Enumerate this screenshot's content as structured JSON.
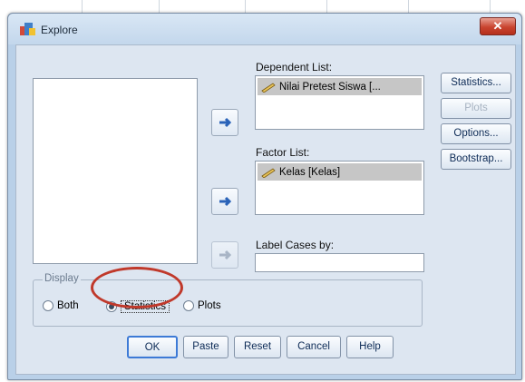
{
  "window": {
    "title": "Explore",
    "close_glyph": "✕"
  },
  "buttons_side": {
    "statistics": "Statistics...",
    "plots": "Plots",
    "options": "Options...",
    "bootstrap": "Bootstrap..."
  },
  "lists": {
    "dependent_label": "Dependent List:",
    "dependent_items": [
      "Nilai Pretest Siswa [..."
    ],
    "factor_label": "Factor List:",
    "factor_items": [
      "Kelas [Kelas]"
    ],
    "label_cases_label": "Label Cases by:",
    "label_cases_value": ""
  },
  "display": {
    "legend": "Display",
    "options": [
      {
        "label": "Both",
        "selected": false
      },
      {
        "label": "Statistics",
        "selected": true
      },
      {
        "label": "Plots",
        "selected": false
      }
    ]
  },
  "buttons_bottom": {
    "ok": "OK",
    "paste": "Paste",
    "reset": "Reset",
    "cancel": "Cancel",
    "help": "Help"
  },
  "icons": {
    "app": "explore-app-icon",
    "move_arrow": "arrow-right-icon",
    "variable": "scale-variable-ruler-icon",
    "close": "close-icon"
  },
  "colors": {
    "highlight_ring": "#c0392b",
    "client_bg": "#dde6f1",
    "close_button": "#c9442f"
  }
}
